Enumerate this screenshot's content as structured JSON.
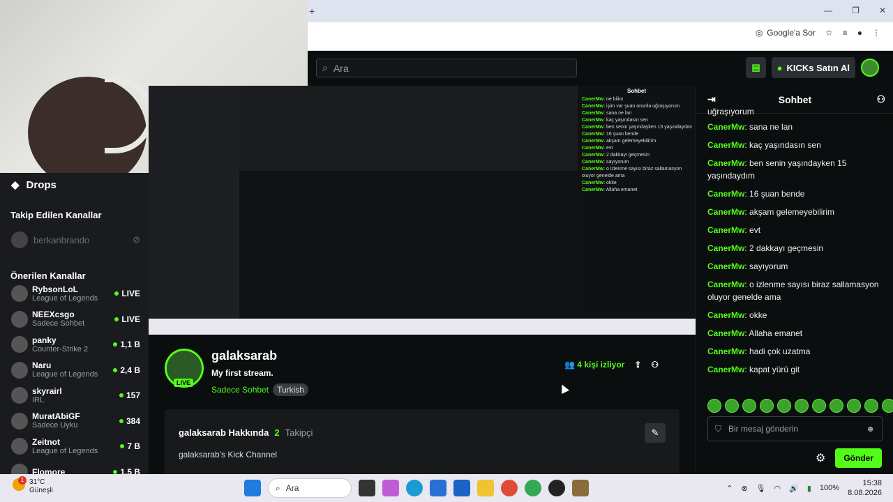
{
  "browser": {
    "google_lens": "Google'a Sor",
    "new_tab": "+"
  },
  "header": {
    "search_placeholder": "Ara",
    "kicks_button": "KICKs Satın Al"
  },
  "sidebar": {
    "drops": "Drops",
    "followed_title": "Takip Edilen Kanallar",
    "followed": [
      {
        "name": "berkanbrando"
      }
    ],
    "recommended_title": "Önerilen Kanallar",
    "channels": [
      {
        "name": "RybsonLoL",
        "game": "League of Legends",
        "viewers": "LIVE"
      },
      {
        "name": "NEEXcsgo",
        "game": "Sadece Sohbet",
        "viewers": "LIVE"
      },
      {
        "name": "panky",
        "game": "Counter-Strike 2",
        "viewers": "1,1 B"
      },
      {
        "name": "Naru",
        "game": "League of Legends",
        "viewers": "2,4 B"
      },
      {
        "name": "skyrairl",
        "game": "IRL",
        "viewers": "157"
      },
      {
        "name": "MuratAbiGF",
        "game": "Sadece Uyku",
        "viewers": "384"
      },
      {
        "name": "Zeitnot",
        "game": "League of Legends",
        "viewers": "7 B"
      },
      {
        "name": "Flomore",
        "game": "",
        "viewers": "1,5 B"
      }
    ]
  },
  "channel": {
    "name": "galaksarab",
    "live": "LIVE",
    "title": "My first stream.",
    "category": "Sadece Sohbet",
    "tag": "Turkish",
    "viewers_count": "4",
    "viewers_label": "kişi izliyor",
    "about_title": "galaksarab Hakkında",
    "followers_count": "2",
    "followers_label": "Takipçi",
    "description": "galaksarab's Kick Channel"
  },
  "chat": {
    "title": "Sohbet",
    "partial": "uğraşıyorum",
    "messages": [
      {
        "user": "CanerMw",
        "text": "sana ne lan"
      },
      {
        "user": "CanerMw",
        "text": "kaç yaşındasın sen"
      },
      {
        "user": "CanerMw",
        "text": "ben senin yaşındayken 15 yaşındaydım"
      },
      {
        "user": "CanerMw",
        "text": "16 şuan bende"
      },
      {
        "user": "CanerMw",
        "text": "akşam gelemeyebilirim"
      },
      {
        "user": "CanerMw",
        "text": "evt"
      },
      {
        "user": "CanerMw",
        "text": "2 dakkayı geçmesin"
      },
      {
        "user": "CanerMw",
        "text": "sayıyorum"
      },
      {
        "user": "CanerMw",
        "text": "o izlenme sayısı biraz sallamasyon oluyor genelde ama"
      },
      {
        "user": "CanerMw",
        "text": "okke"
      },
      {
        "user": "CanerMw",
        "text": "Allaha emanet"
      },
      {
        "user": "CanerMw",
        "text": "hadi çok uzatma"
      },
      {
        "user": "CanerMw",
        "text": "kapat yürü git"
      }
    ],
    "input_placeholder": "Bir mesaj gönderin",
    "send": "Gönder"
  },
  "nested": {
    "chat_title": "Sohbet",
    "lines": [
      {
        "user": "CanerMw",
        "text": "ne bilim"
      },
      {
        "user": "CanerMw",
        "text": "işim var şuan onunla uğraşıyorum"
      },
      {
        "user": "CanerMw",
        "text": "sana ne lan"
      },
      {
        "user": "CanerMw",
        "text": "kaç yaşındasın sen"
      },
      {
        "user": "CanerMw",
        "text": "ben senin yaşındayken 15 yaşındaydım"
      },
      {
        "user": "CanerMw",
        "text": "16 şuan bende"
      },
      {
        "user": "CanerMw",
        "text": "akşam gelemeyebilirim"
      },
      {
        "user": "CanerMw",
        "text": "evt"
      },
      {
        "user": "CanerMw",
        "text": "2 dakkayı geçmesin"
      },
      {
        "user": "CanerMw",
        "text": "sayıyorum"
      },
      {
        "user": "CanerMw",
        "text": "o izlenme sayısı biraz sallamasyon oluyor genelde ama"
      },
      {
        "user": "CanerMw",
        "text": "okke"
      },
      {
        "user": "CanerMw",
        "text": "Allaha emanet"
      }
    ]
  },
  "taskbar": {
    "temp": "31°C",
    "weather": "Güneşli",
    "badge": "1",
    "search": "Ara",
    "battery": "100%",
    "time": "15:38",
    "date": "8.08.2026"
  },
  "colors": {
    "accent": "#53fc18",
    "bg": "#0b0e0f"
  }
}
